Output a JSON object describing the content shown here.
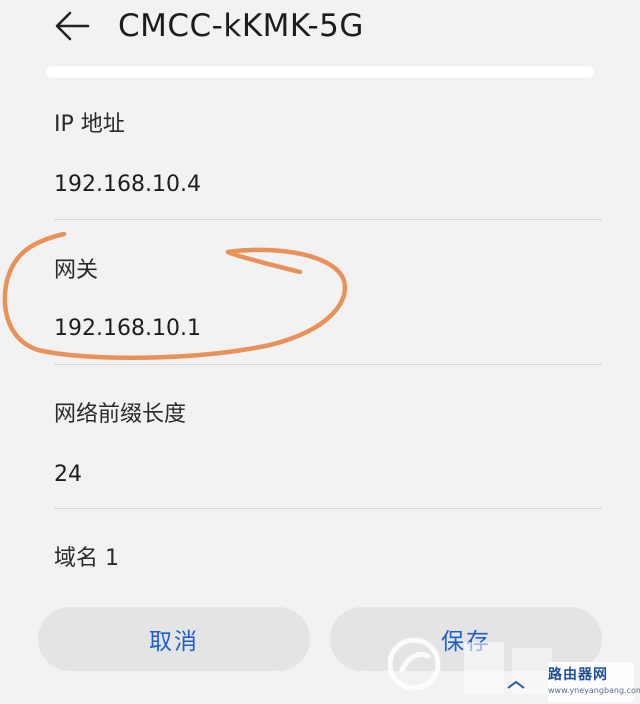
{
  "header": {
    "back_icon": "arrow-left-icon",
    "title": "CMCC-kKMK-5G"
  },
  "fields": [
    {
      "label": "IP 地址",
      "value": "192.168.10.4"
    },
    {
      "label": "网关",
      "value": "192.168.10.1"
    },
    {
      "label": "网络前缀长度",
      "value": "24"
    },
    {
      "label": "域名 1",
      "value": ""
    }
  ],
  "actions": {
    "cancel_label": "取消",
    "save_label": "保存"
  },
  "watermark": {
    "brand": "路由器网",
    "url": "www.yneyangbang.com"
  },
  "colors": {
    "accent": "#1f5fc9",
    "annotation": "#e8925a",
    "background": "#f2f2f2"
  }
}
